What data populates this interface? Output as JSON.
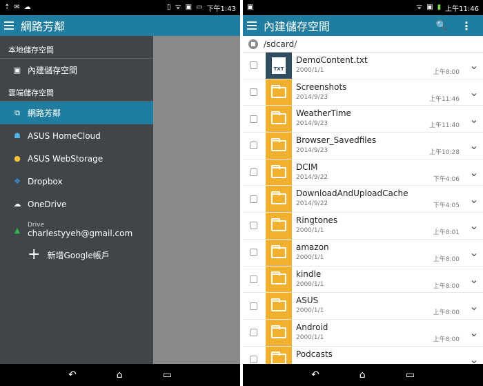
{
  "left": {
    "status": {
      "glyphs": [
        "⇡",
        "✉",
        "☁"
      ],
      "right_glyphs": [
        "▯",
        "ᯤ",
        "▣",
        "▭"
      ],
      "time": "下午1:43"
    },
    "appbar": {
      "title": "網路芳鄰"
    },
    "drawer": {
      "section_local": "本地儲存空間",
      "local_item": "內建儲存空間",
      "section_cloud": "雲端儲存空間",
      "items": [
        {
          "label": "網路芳鄰",
          "icon": "network-icon",
          "active": true
        },
        {
          "label": "ASUS HomeCloud",
          "icon": "homecloud-icon"
        },
        {
          "label": "ASUS WebStorage",
          "icon": "webstorage-icon"
        },
        {
          "label": "Dropbox",
          "icon": "dropbox-icon"
        },
        {
          "label": "OneDrive",
          "icon": "onedrive-icon"
        }
      ],
      "drive": {
        "label": "Drive",
        "account": "charlestyyeh@gmail.com",
        "icon": "google-drive-icon"
      },
      "add_account": "新增Google帳戶"
    },
    "nav": {
      "back": "↶",
      "home": "⌂",
      "recent": "▭"
    }
  },
  "right": {
    "status": {
      "glyphs": [
        "▣"
      ],
      "right_glyphs": [
        "ᯤ",
        "▣",
        "▮"
      ],
      "time": "上午11:46"
    },
    "appbar": {
      "title": "內建儲存空間",
      "search": "🔍",
      "more": "⋮"
    },
    "path": "/sdcard/",
    "files": [
      {
        "name": "DemoContent.txt",
        "date": "2000/1/1",
        "time": "上午8:00",
        "type": "txt",
        "badge": "TXT"
      },
      {
        "name": "Screenshots",
        "date": "2014/9/23",
        "time": "上午11:46",
        "type": "folder"
      },
      {
        "name": "WeatherTime",
        "date": "2014/9/23",
        "time": "上午11:40",
        "type": "folder"
      },
      {
        "name": "Browser_Savedfiles",
        "date": "2014/9/23",
        "time": "上午10:28",
        "type": "folder"
      },
      {
        "name": "DCIM",
        "date": "2014/9/22",
        "time": "下午4:06",
        "type": "folder"
      },
      {
        "name": "DownloadAndUploadCache",
        "date": "2014/9/22",
        "time": "下午4:05",
        "type": "folder"
      },
      {
        "name": "Ringtones",
        "date": "2000/1/1",
        "time": "上午8:01",
        "type": "folder"
      },
      {
        "name": "amazon",
        "date": "2000/1/1",
        "time": "上午8:00",
        "type": "folder"
      },
      {
        "name": "kindle",
        "date": "2000/1/1",
        "time": "上午8:00",
        "type": "folder"
      },
      {
        "name": "ASUS",
        "date": "2000/1/1",
        "time": "上午8:00",
        "type": "folder"
      },
      {
        "name": "Android",
        "date": "2000/1/1",
        "time": "上午8:00",
        "type": "folder"
      },
      {
        "name": "Podcasts",
        "date": "",
        "time": "",
        "type": "folder"
      }
    ],
    "nav": {
      "back": "↶",
      "home": "⌂",
      "recent": "▭"
    }
  }
}
